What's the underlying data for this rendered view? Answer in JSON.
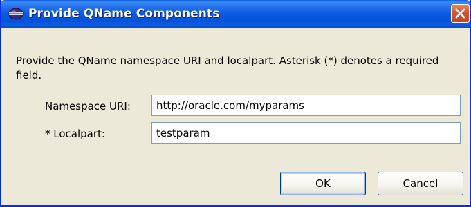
{
  "window": {
    "title": "Provide QName Components",
    "title_icon": "eclipse-window-icon",
    "close_icon": "close-icon"
  },
  "dialog": {
    "description": "Provide the QName namespace URI and localpart.  Asterisk (*) denotes a required field."
  },
  "form": {
    "namespace_label": "Namespace URI:",
    "namespace_value": "http://oracle.com/myparams",
    "localpart_label": "* Localpart:",
    "localpart_value": "testparam"
  },
  "buttons": {
    "ok_label": "OK",
    "cancel_label": "Cancel"
  },
  "colors": {
    "titlebar": "#0C5AE0",
    "dialog_background": "#ECE9D8",
    "close_button": "#D7542E",
    "input_border": "#7F9DB9"
  }
}
